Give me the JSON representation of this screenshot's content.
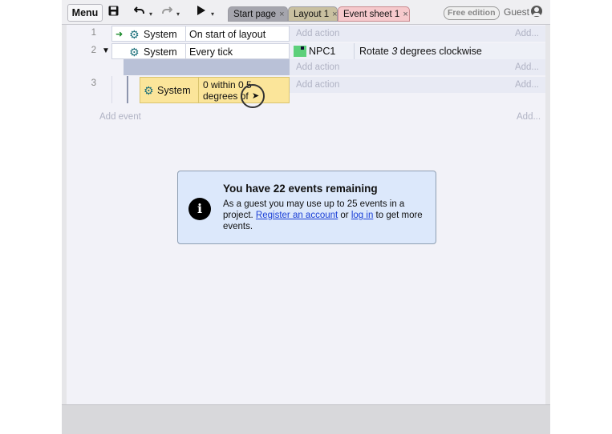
{
  "toolbar": {
    "menu_label": "Menu",
    "icons": [
      "save-icon",
      "undo-icon",
      "redo-icon",
      "play-icon"
    ],
    "free_badge": "Free edition",
    "guest_label": "Guest"
  },
  "tabs": [
    {
      "label": "Start page",
      "close": "×"
    },
    {
      "label": "Layout 1",
      "close": "×"
    },
    {
      "label": "Event sheet 1",
      "close": "×"
    }
  ],
  "events": [
    {
      "number": "1",
      "condition_object": "System",
      "condition_text": "On start of layout",
      "add_action": "Add action",
      "add_tail": "Add..."
    },
    {
      "number": "2",
      "condition_object": "System",
      "condition_text": "Every tick",
      "action_object": "NPC1",
      "action_text_pre": "Rotate ",
      "action_text_num": "3",
      "action_text_post": " degrees clockwise",
      "sub_add_action": "Add action",
      "sub_add_tail": "Add..."
    },
    {
      "number": "3",
      "condition_object": "System",
      "condition_text": "0 within 0.5 degrees of",
      "add_action": "Add action",
      "add_tail": "Add..."
    }
  ],
  "add_event": "Add event",
  "add_event_tail": "Add...",
  "dialog": {
    "title": "You have 22 events remaining",
    "body_pre": "As a guest you may use up to 25 events in a project. ",
    "register_link": "Register an account",
    "mid": " or ",
    "login_link": "log in",
    "body_post": " to get more events.",
    "icon": "info-icon"
  },
  "colors": {
    "system_highlight": "#fbe59a",
    "npc_swatch": "#5cd07a",
    "dialog_bg": "#dce8fb",
    "link": "#1a3fd6"
  }
}
